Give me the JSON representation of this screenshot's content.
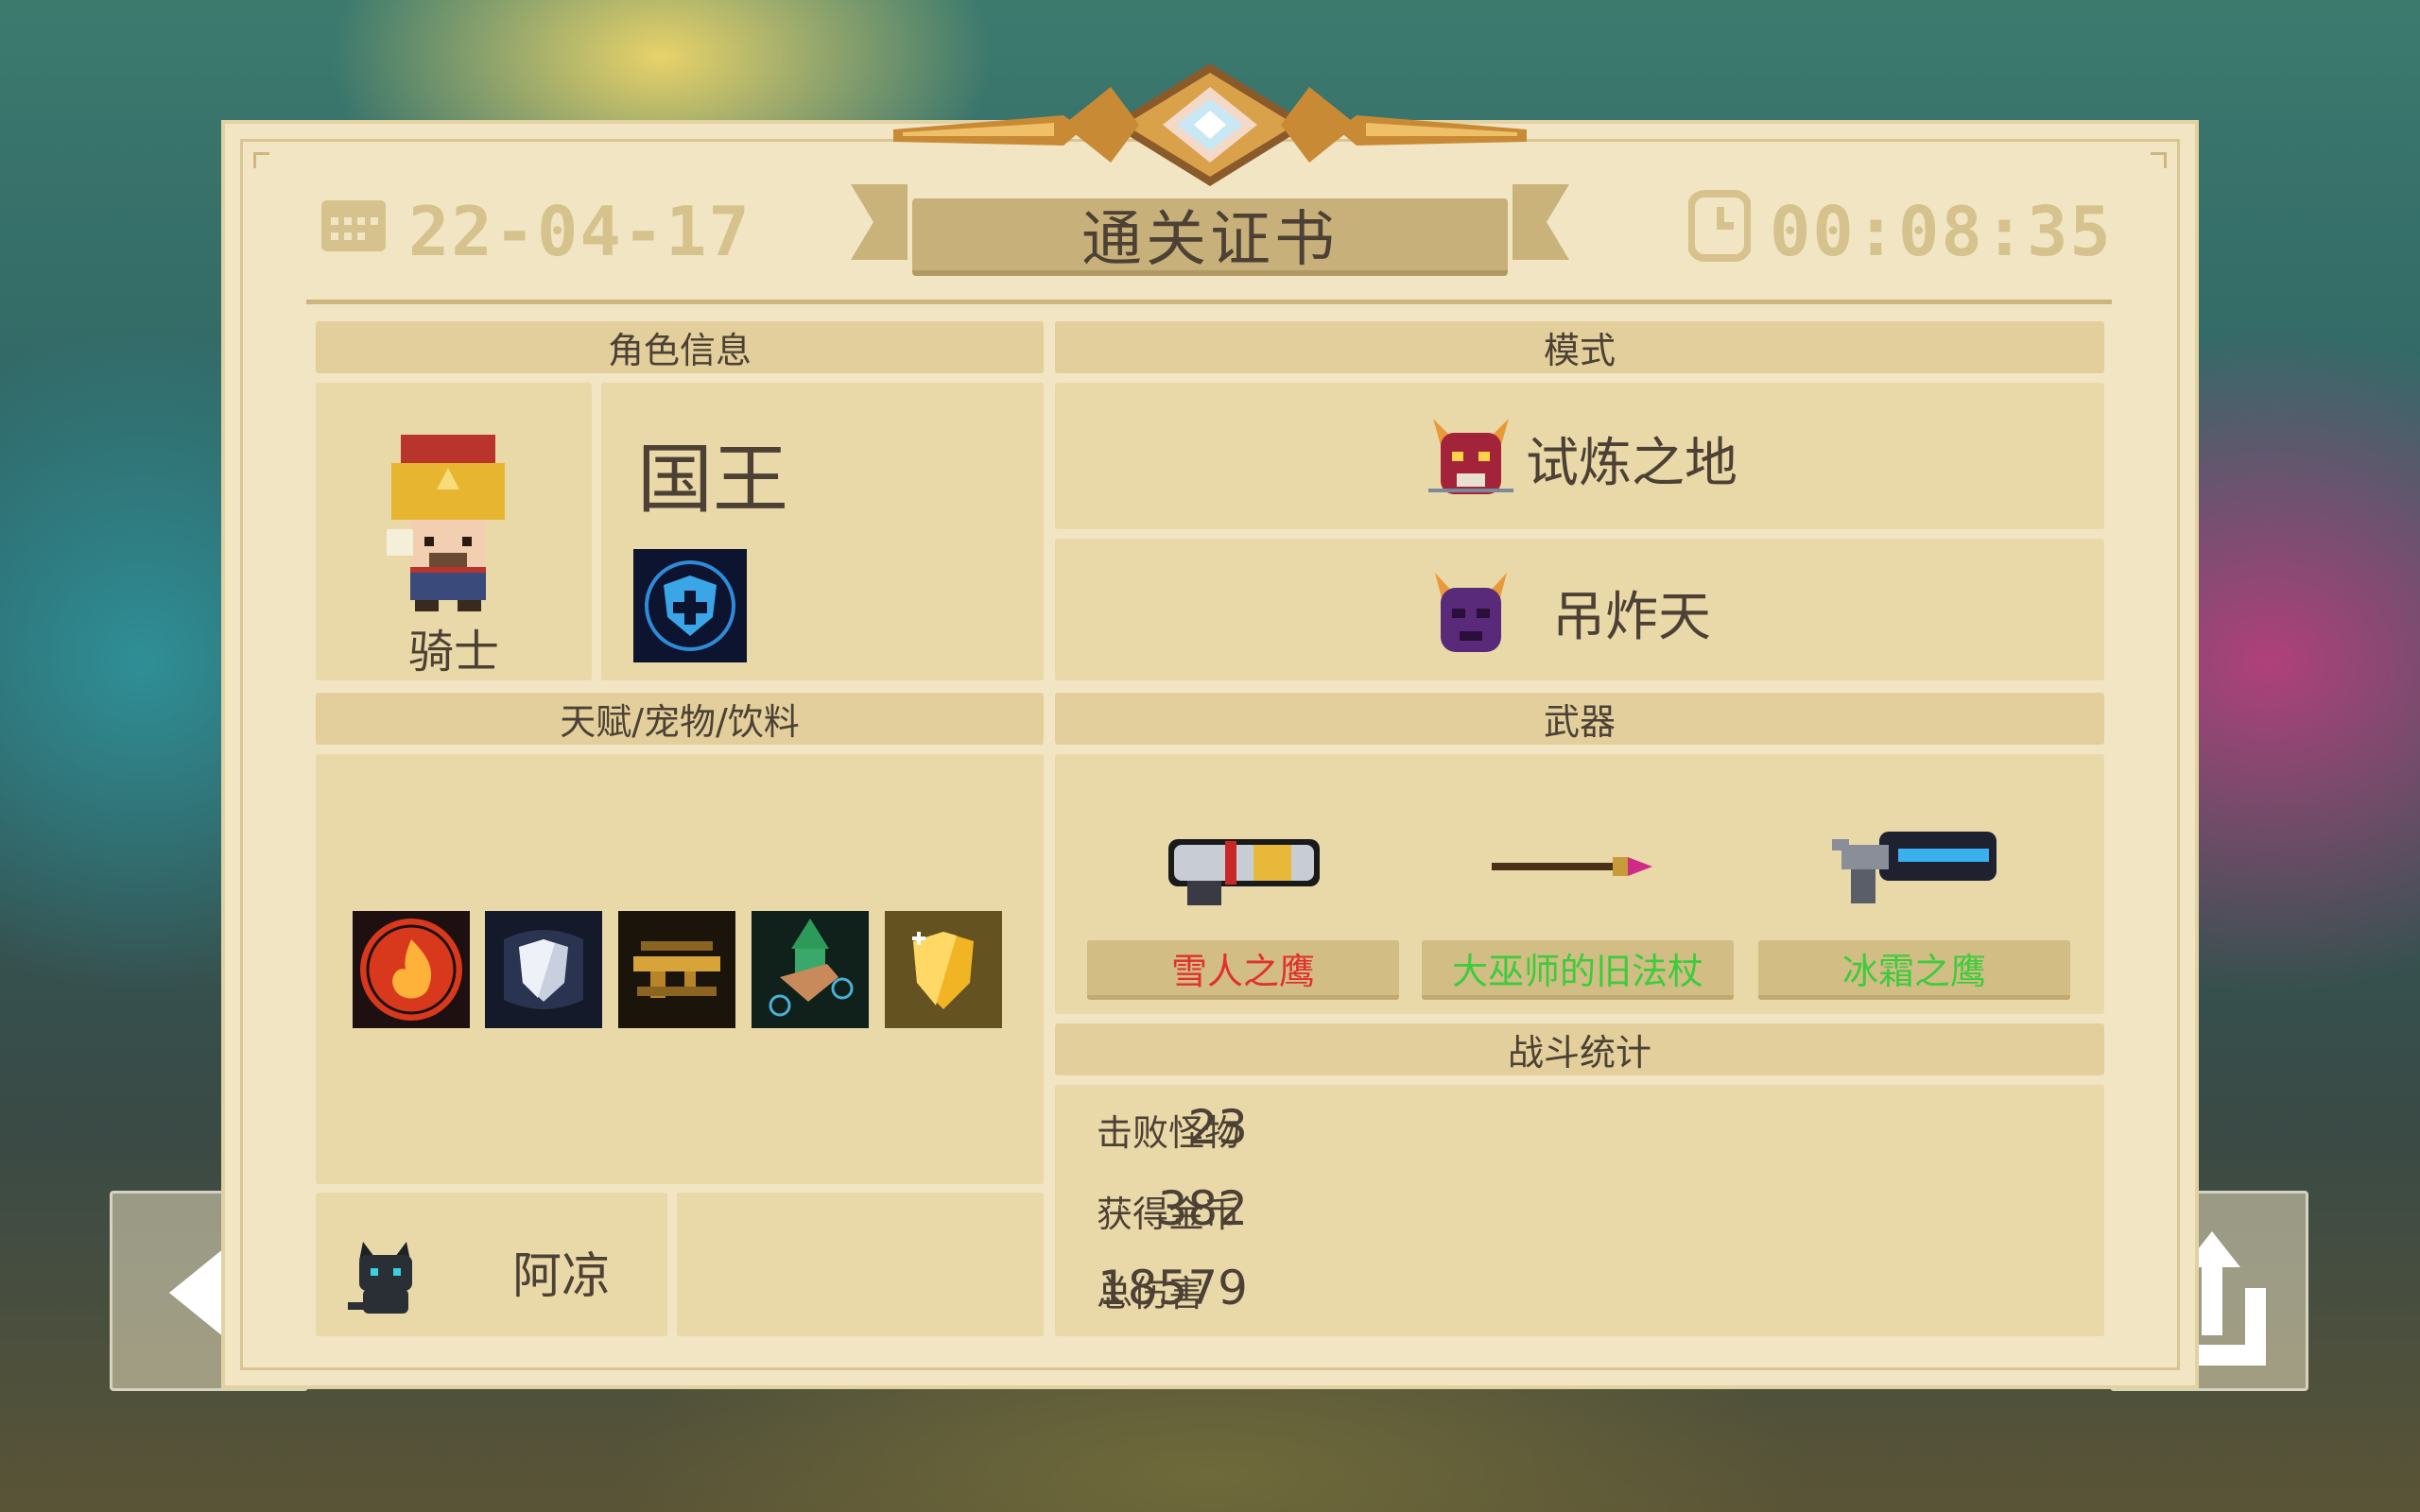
{
  "certificate": {
    "title": "通关证书",
    "date": "22-04-17",
    "time": "00:08:35"
  },
  "character_section": {
    "header": "角色信息",
    "class_name": "骑士",
    "skin_name": "国王"
  },
  "mode_section": {
    "header": "模式",
    "mode": "试炼之地",
    "boss": "吊炸天"
  },
  "buffs_section": {
    "header": "天赋/宠物/饮料",
    "buff_icons": [
      "fire-talent-icon",
      "silver-shield-talent-icon",
      "golden-rifle-talent-icon",
      "green-warrior-talent-icon",
      "gold-shield-talent-icon"
    ],
    "pet_name": "阿凉"
  },
  "weapons_section": {
    "header": "武器",
    "weapons": [
      {
        "name": "雪人之鹰",
        "color": "#e03030"
      },
      {
        "name": "大巫师的旧法杖",
        "color": "#3dcc3d"
      },
      {
        "name": "冰霜之鹰",
        "color": "#3dcc3d"
      }
    ]
  },
  "stats_section": {
    "header": "战斗统计",
    "stats": [
      {
        "label": "击败怪物",
        "value": "23"
      },
      {
        "label": "获得金币",
        "value": "382"
      },
      {
        "label": "总伤害",
        "value": "18579"
      }
    ]
  },
  "colors": {
    "card_bg": "#f1e5c3",
    "panel_bg": "#e9d8a8",
    "text": "#4c4134",
    "red_weapon": "#e03030",
    "green_weapon": "#3dcc3d"
  }
}
